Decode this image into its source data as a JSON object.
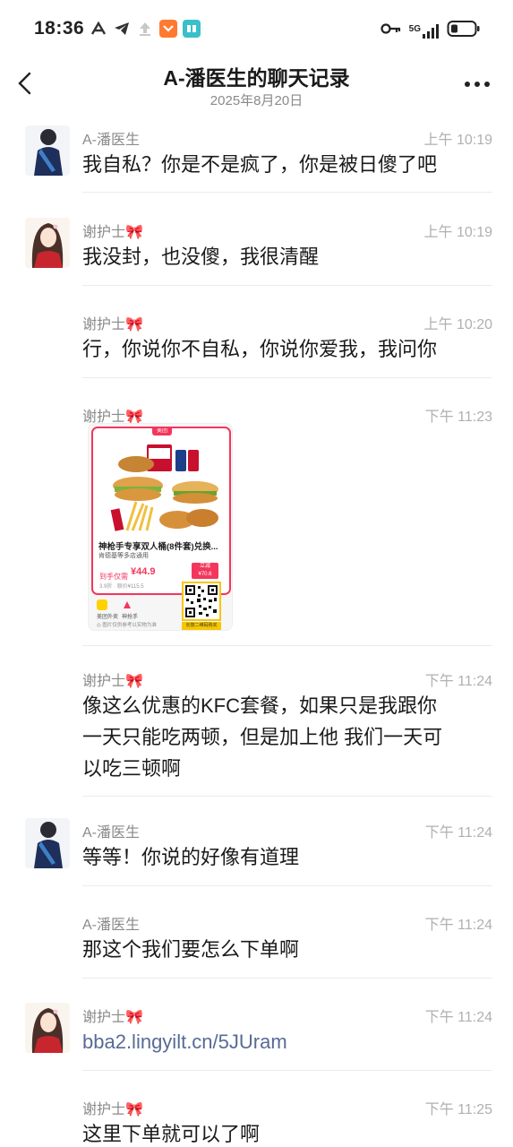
{
  "status_bar": {
    "time": "18:36",
    "network": "5G",
    "left_icons": [
      "signal-a-icon",
      "telegram-icon",
      "upload-icon",
      "pocket-icon",
      "book-icon"
    ],
    "right_icons": [
      "key-icon",
      "cellular-icon",
      "battery-icon"
    ]
  },
  "header": {
    "title": "A-潘医生的聊天记录",
    "subtitle": "2025年8月20日"
  },
  "messages": [
    {
      "sender": "A-潘医生",
      "time": "上午 10:19",
      "text": "我自私？你是不是疯了，你是被日傻了吧",
      "avatar": "doctor"
    },
    {
      "sender": "谢护士🎀",
      "time": "上午 10:19",
      "text": "我没封，也没傻，我很清醒",
      "avatar": "nurse"
    },
    {
      "sender": "谢护士🎀",
      "time": "上午 10:20",
      "text": "行，你说你不自私，你说你爱我，我问你",
      "avatar": ""
    },
    {
      "sender": "谢护士🎀",
      "time": "下午 11:23",
      "text": "",
      "avatar": ""
    },
    {
      "sender": "谢护士🎀",
      "time": "下午 11:24",
      "text_lines": [
        "像这么优惠的KFC套餐，如果只是我跟你",
        "一天只能吃两顿，但是加上他 我们一天可",
        "以吃三顿啊"
      ],
      "avatar": ""
    },
    {
      "sender": "A-潘医生",
      "time": "下午 11:24",
      "text": "等等！你说的好像有道理",
      "avatar": "doctor"
    },
    {
      "sender": "A-潘医生",
      "time": "下午 11:24",
      "text": "那这个我们要怎么下单啊",
      "avatar": ""
    },
    {
      "sender": "谢护士🎀",
      "time": "下午 11:24",
      "text": "bba2.lingyilt.cn/5JUram",
      "avatar": "nurse"
    },
    {
      "sender": "谢护士🎀",
      "time": "下午 11:25",
      "text": "这里下单就可以了啊",
      "avatar": ""
    }
  ],
  "kfc_card": {
    "badge": "美团",
    "title": "神枪手专享双人桶(8件套)兑换...",
    "subtitle": "肯德基等多店通用",
    "price_label": "到手仅需",
    "price": "¥44.9",
    "original": "3.9折 · 原价¥115.5",
    "tag_line1": "立减",
    "tag_line2": "¥70.6",
    "brand1": "美团外卖",
    "brand2": "神抢手",
    "note": "◎ 图片仅供参考以实物为准",
    "qr_label": "长按二维码购买"
  },
  "colors": {
    "accent_pink": "#f4365c",
    "link_blue": "#576b95",
    "time_gray": "#b0b0b0",
    "name_gray": "#8a8a8a"
  }
}
